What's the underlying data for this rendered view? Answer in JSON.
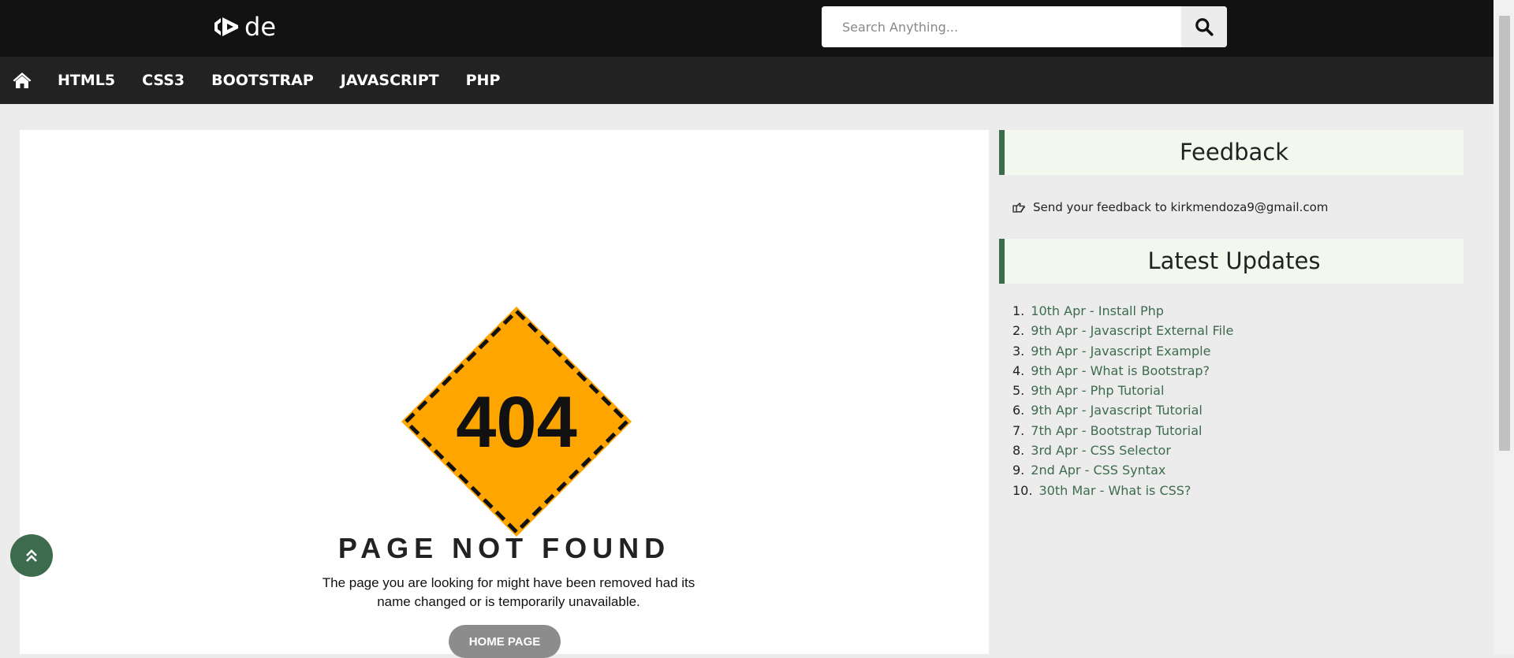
{
  "header": {
    "logo_text": "de",
    "search": {
      "placeholder": "Search Anything..."
    }
  },
  "nav": {
    "items": [
      {
        "label": "HTML5"
      },
      {
        "label": "CSS3"
      },
      {
        "label": "BOOTSTRAP"
      },
      {
        "label": "JAVASCRIPT"
      },
      {
        "label": "PHP"
      }
    ]
  },
  "main": {
    "sign_code": "404",
    "title": "PAGE NOT FOUND",
    "description": "The page you are looking for might have been removed had its name changed or is temporarily unavailable.",
    "home_button": "HOME PAGE"
  },
  "sidebar": {
    "feedback_heading": "Feedback",
    "feedback_text": "Send your feedback to kirkmendoza9@gmail.com",
    "updates_heading": "Latest Updates",
    "updates": [
      {
        "num": "1.",
        "label": "10th Apr - Install Php"
      },
      {
        "num": "2.",
        "label": "9th Apr - Javascript External File"
      },
      {
        "num": "3.",
        "label": "9th Apr - Javascript Example"
      },
      {
        "num": "4.",
        "label": "9th Apr - What is Bootstrap?"
      },
      {
        "num": "5.",
        "label": "9th Apr - Php Tutorial"
      },
      {
        "num": "6.",
        "label": "9th Apr - Javascript Tutorial"
      },
      {
        "num": "7.",
        "label": "7th Apr - Bootstrap Tutorial"
      },
      {
        "num": "8.",
        "label": "3rd Apr - CSS Selector"
      },
      {
        "num": "9.",
        "label": "2nd Apr - CSS Syntax"
      },
      {
        "num": "10.",
        "label": "30th Mar - What is CSS?"
      }
    ]
  },
  "icons": {
    "home": "home-icon",
    "search": "search-icon",
    "feedback": "hand-pointer-icon",
    "scroll_top": "double-chevron-up-icon"
  },
  "colors": {
    "topbar": "#121212",
    "navbar": "#222222",
    "accent": "#3d6b4e",
    "sign": "#ffa500",
    "home_button": "#8c8c8c"
  }
}
